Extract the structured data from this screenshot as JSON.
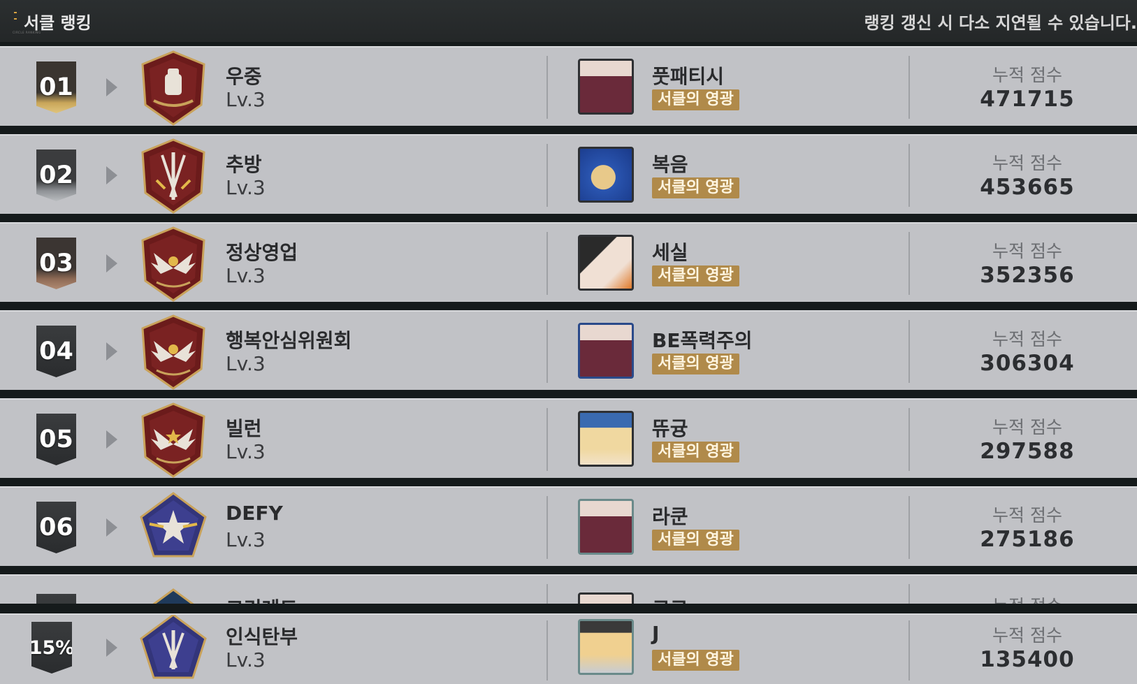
{
  "header": {
    "title": "서클 랭킹",
    "tiny_label": "CIRCLE RANKING",
    "notice": "랭킹 갱신 시 다소 지연될 수 있습니다."
  },
  "rows": [
    {
      "rank": "01",
      "circle_name": "우중",
      "level": "Lv.3",
      "leader_name": "풋패티시",
      "title_badge": "서클의 영광",
      "score_label": "누적 점수",
      "score": "471715"
    },
    {
      "rank": "02",
      "circle_name": "추방",
      "level": "Lv.3",
      "leader_name": "복음",
      "title_badge": "서클의 영광",
      "score_label": "누적 점수",
      "score": "453665"
    },
    {
      "rank": "03",
      "circle_name": "정상영업",
      "level": "Lv.3",
      "leader_name": "세실",
      "title_badge": "서클의 영광",
      "score_label": "누적 점수",
      "score": "352356"
    },
    {
      "rank": "04",
      "circle_name": "행복안심위원회",
      "level": "Lv.3",
      "leader_name": "BE폭력주의",
      "title_badge": "서클의 영광",
      "score_label": "누적 점수",
      "score": "306304"
    },
    {
      "rank": "05",
      "circle_name": "빌런",
      "level": "Lv.3",
      "leader_name": "뜌귱",
      "title_badge": "서클의 영광",
      "score_label": "누적 점수",
      "score": "297588"
    },
    {
      "rank": "06",
      "circle_name": "DEFY",
      "level": "Lv.3",
      "leader_name": "라쿤",
      "title_badge": "서클의 영광",
      "score_label": "누적 점수",
      "score": "275186"
    },
    {
      "rank": "",
      "circle_name": "크리레드",
      "level": "",
      "leader_name": "코코",
      "title_badge": "",
      "score_label": "누적 점수",
      "score": ""
    }
  ],
  "my_circle": {
    "rank": "15%",
    "circle_name": "인식탄부",
    "level": "Lv.3",
    "leader_name": "J",
    "title_badge": "서클의 영광",
    "score_label": "누적 점수",
    "score": "135400"
  },
  "colors": {
    "badge": "#b08a4a",
    "row_bg": "#c1c2c6",
    "separator": "#151a1b",
    "emblem_red": "#7a1f1f",
    "emblem_blue": "#3d3f8f"
  },
  "icons": [
    "play-arrow-icon",
    "fist-emblem-icon",
    "sword-emblem-icon",
    "wings-emblem-icon",
    "star-emblem-icon"
  ]
}
